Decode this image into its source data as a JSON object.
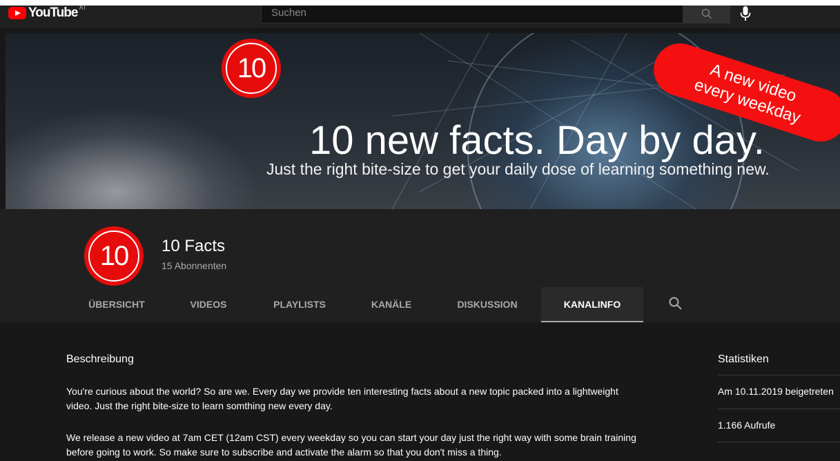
{
  "header": {
    "logo_text": "YouTube",
    "logo_country": "AT",
    "search_placeholder": "Suchen",
    "search_icon": "search-icon",
    "mic_icon": "mic-icon"
  },
  "banner": {
    "logo_number": "10",
    "pill_text_line1": "A new video",
    "pill_text_line2": "every weekday",
    "headline": "10 new facts. Day by day.",
    "subline": "Just the right bite-size to get your daily dose of learning something new."
  },
  "channel": {
    "avatar_number": "10",
    "name": "10 Facts",
    "subscribers": "15 Abonnenten"
  },
  "tabs": [
    {
      "label": "ÜBERSICHT"
    },
    {
      "label": "VIDEOS"
    },
    {
      "label": "PLAYLISTS"
    },
    {
      "label": "KANÄLE"
    },
    {
      "label": "DISKUSSION"
    },
    {
      "label": "KANALINFO",
      "active": true
    }
  ],
  "about": {
    "title": "Beschreibung",
    "paragraph1": "You're curious about the world? So are we. Every day we provide ten interesting facts about a new topic packed into a lightweight video. Just the right bite-size to learn somthing new every day.",
    "paragraph2": "We release a new video at 7am CET (12am CST) every weekday so you can start your day just the right way with some brain training before going to work. So make sure to subscribe and activate the alarm so that you don't miss a thing."
  },
  "stats": {
    "title": "Statistiken",
    "joined": "Am 10.11.2019 beigetreten",
    "views": "1.166 Aufrufe"
  },
  "colors": {
    "brand_red": "#e60c0c",
    "page_bg": "#181818",
    "header_bg": "#202020"
  }
}
